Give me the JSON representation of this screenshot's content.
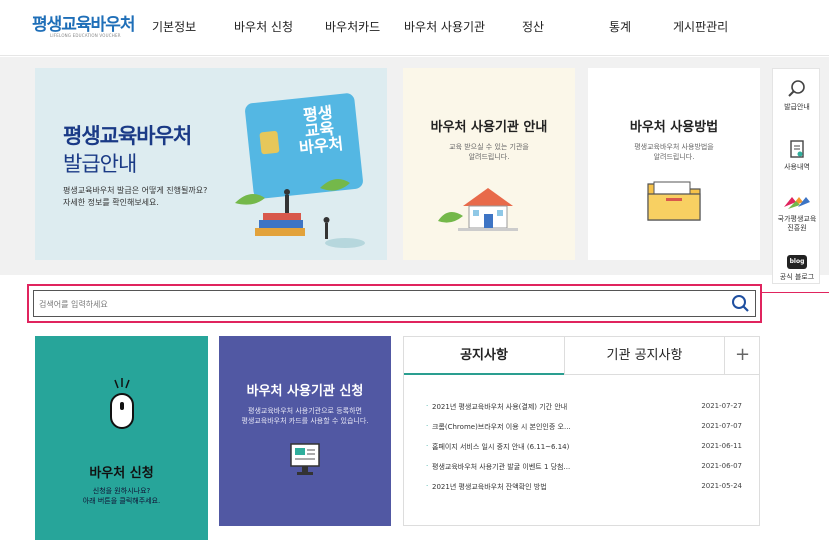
{
  "header": {
    "logo_main": "평생교육바우처",
    "logo_sub": "LIFELONG EDUCATION VOUCHER",
    "nav": [
      "기본정보",
      "바우처 신청",
      "바우처카드",
      "바우처 사용기관",
      "정산",
      "통계",
      "게시판관리"
    ]
  },
  "hero": {
    "main": {
      "title1": "평생교육바우처",
      "title2": "발급안내",
      "desc1": "평생교육바우처 발급은 어떻게 진행될까요?",
      "desc2": "자세한 정보를 확인해보세요.",
      "card_text": "평생\n교육\n바우처"
    },
    "institutions": {
      "title": "바우처 사용기관 안내",
      "desc1": "교육 받으실 수 있는 기관을",
      "desc2": "알려드립니다."
    },
    "usage": {
      "title": "바우처 사용방법",
      "desc1": "평생교육바우처 사용방법을",
      "desc2": "알려드립니다."
    }
  },
  "sidebar": {
    "items": [
      {
        "label": "발급안내",
        "icon": "search-icon"
      },
      {
        "label": "사용내역",
        "icon": "document-icon"
      },
      {
        "label": "국가평생교육\n진흥원",
        "icon": "nile-logo-icon"
      },
      {
        "label": "공식 블로그",
        "icon": "blog-icon",
        "badge": "blog"
      }
    ]
  },
  "search": {
    "placeholder": "검색어를 입력하세요",
    "value": ""
  },
  "apply": {
    "title": "바우처 신청",
    "desc1": "신청을 원하시나요?",
    "desc2": "아래 버튼을 클릭해주세요."
  },
  "institution_apply": {
    "title": "바우처 사용기관 신청",
    "desc1": "평생교육바우처 사용기관으로 등록하면",
    "desc2": "평생교육바우처 카드를 사용할 수 있습니다."
  },
  "notices": {
    "tabs": [
      "공지사항",
      "기관 공지사항"
    ],
    "more": "+",
    "items": [
      {
        "title": "2021년 평생교육바우처 사용(결제) 기간 안내",
        "date": "2021-07-27"
      },
      {
        "title": "크롬(Chrome)브라우저 이용 시 본인인증 오...",
        "date": "2021-07-07"
      },
      {
        "title": "홈페이지 서비스 일시 중지 안내 (6.11~6.14)",
        "date": "2021-06-11"
      },
      {
        "title": "평생교육바우처 사용기관 발굴 이벤트 1 당첨...",
        "date": "2021-06-07"
      },
      {
        "title": "2021년 평생교육바우처 잔액확인 방법",
        "date": "2021-05-24"
      }
    ]
  },
  "colors": {
    "primary": "#1f6fb8",
    "teal": "#27a59a",
    "purple": "#5158a3",
    "highlight": "#e0245e"
  }
}
